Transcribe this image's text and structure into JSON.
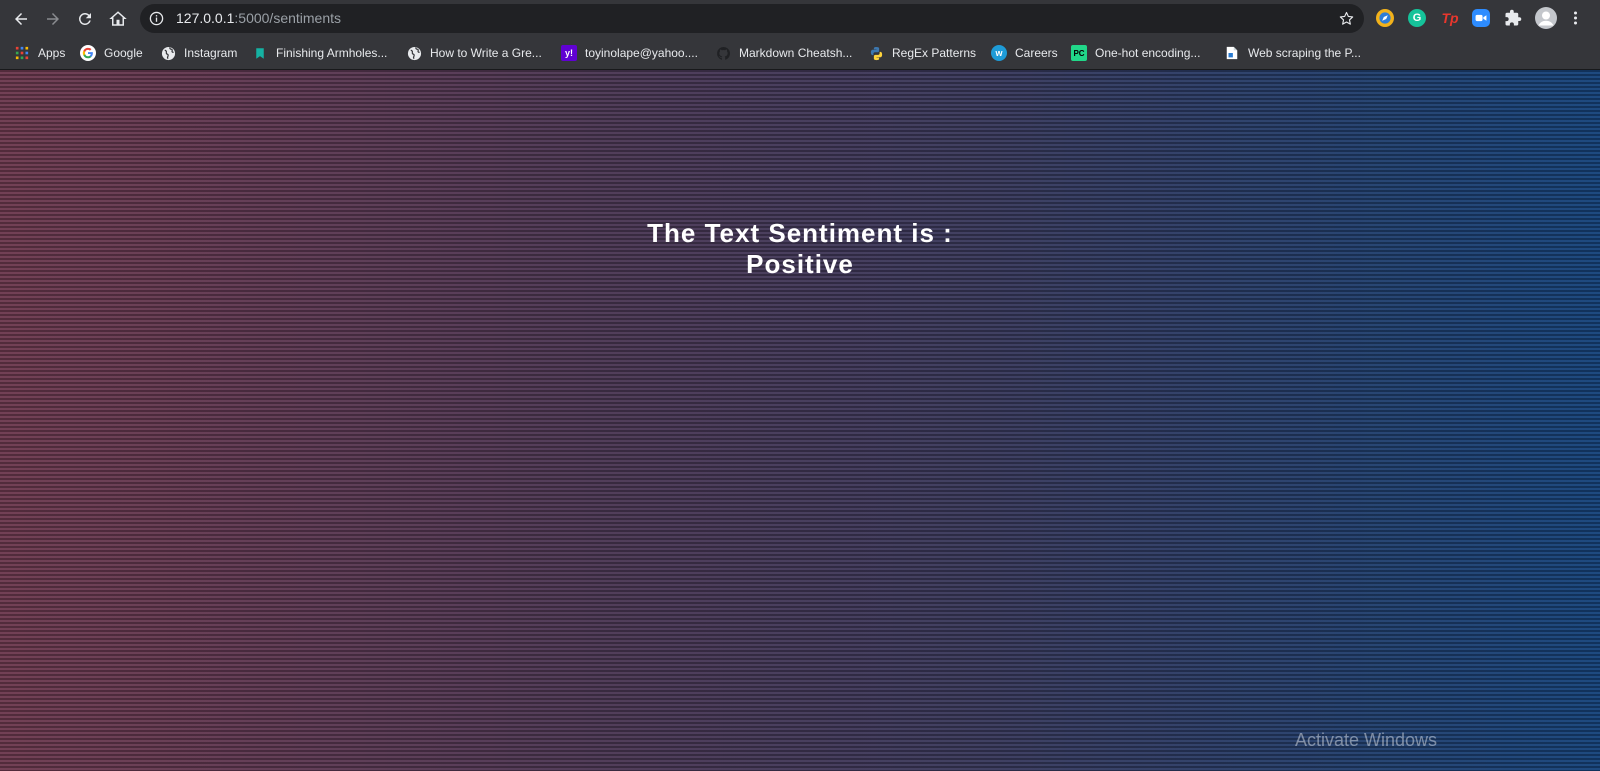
{
  "browser": {
    "url_host": "127.0.0.1",
    "url_path": ":5000/sentiments",
    "nav_icons": [
      "back-icon",
      "forward-icon",
      "reload-icon",
      "home-icon"
    ],
    "extension_icons": [
      "compass-icon",
      "grammarly-icon",
      "tp-icon",
      "zoom-icon",
      "puzzle-icon",
      "profile-icon",
      "menu-icon"
    ],
    "extensions": {
      "grammarly_letter": "G",
      "tp_letters": "Tp"
    }
  },
  "bookmarks": [
    {
      "label": "Apps",
      "icon": "apps-grid-icon"
    },
    {
      "label": "Google",
      "icon": "google-icon"
    },
    {
      "label": "Instagram",
      "icon": "globe-icon"
    },
    {
      "label": "Finishing Armholes...",
      "icon": "bookmark-ribbon-icon"
    },
    {
      "label": "How to Write a Gre...",
      "icon": "globe-icon"
    },
    {
      "label": "toyinolape@yahoo....",
      "icon": "yahoo-icon",
      "icon_text": "y!"
    },
    {
      "label": "Markdown Cheatsh...",
      "icon": "github-icon"
    },
    {
      "label": "RegEx Patterns",
      "icon": "python-icon"
    },
    {
      "label": "Careers",
      "icon": "w-circle-icon",
      "icon_text": "w"
    },
    {
      "label": "One-hot encoding...",
      "icon": "pycharm-icon",
      "icon_text": "PC"
    },
    {
      "label": "Web scraping the P...",
      "icon": "document-icon"
    }
  ],
  "main": {
    "heading_line1": "The Text Sentiment is :",
    "heading_line2": "Positive"
  },
  "os": {
    "watermark": "Activate Windows"
  },
  "colors": {
    "toolbar": "#35363a",
    "omnibox": "#202124",
    "gradient_left": "#6e3a50",
    "gradient_right": "#17447c",
    "text": "#ffffff"
  }
}
